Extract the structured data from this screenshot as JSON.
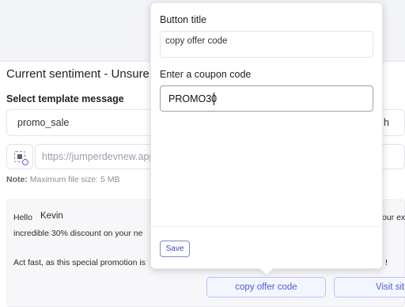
{
  "sentiment": {
    "text": "Current sentiment - Unsure"
  },
  "template": {
    "label": "Select template message",
    "selected": "promo_sale",
    "right_fragment": "h"
  },
  "media": {
    "placeholder": "https://jumperdevnew.app",
    "note_prefix": "Note:",
    "note_text": " Maximum file size: 5 MB"
  },
  "preview": {
    "greeting": "Hello",
    "name": "Kevin",
    "line1": "incredible 30% discount on your ne",
    "line1_right": "our ex",
    "line2": "Act fast, as this special promotion is",
    "line2_right": "!"
  },
  "buttons": {
    "copy_offer": "copy offer code",
    "visit_site": "Visit sit"
  },
  "popover": {
    "button_title_label": "Button title",
    "button_title_value": "copy offer code",
    "coupon_label": "Enter a coupon code",
    "coupon_value": "PROMO30",
    "save_label": "Save"
  }
}
